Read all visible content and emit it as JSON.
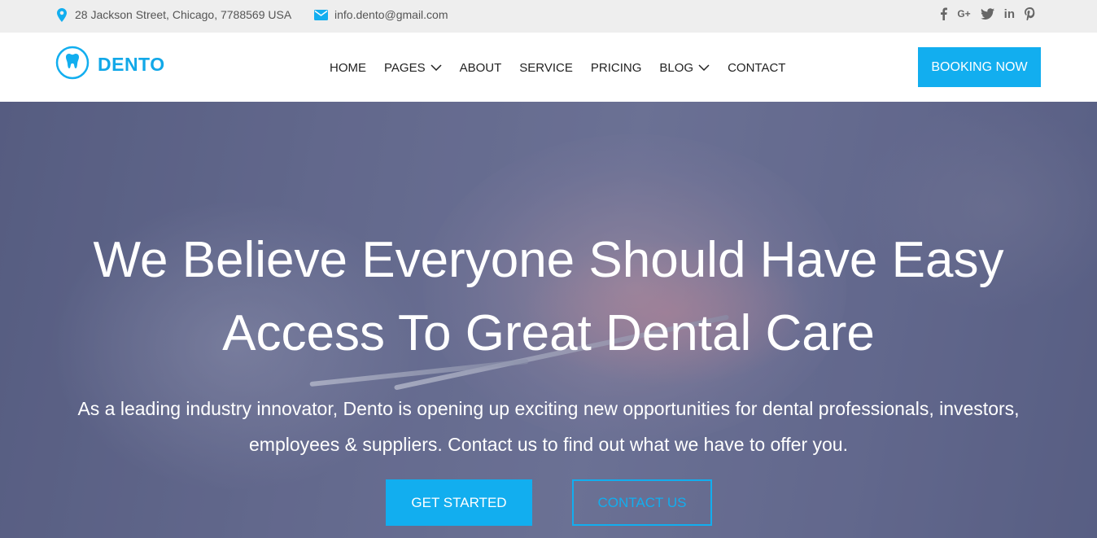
{
  "topbar": {
    "address": "28 Jackson Street, Chicago, 7788569 USA",
    "email": "info.dento@gmail.com",
    "address_icon": "map-pin-icon",
    "email_icon": "envelope-icon",
    "social": [
      {
        "icon": "facebook-icon",
        "glyph": "f"
      },
      {
        "icon": "google-plus-icon",
        "glyph": "G+"
      },
      {
        "icon": "twitter-icon",
        "glyph": ""
      },
      {
        "icon": "linkedin-icon",
        "glyph": "in"
      },
      {
        "icon": "pinterest-icon",
        "glyph": "P"
      }
    ]
  },
  "brand": {
    "name": "DENTO",
    "logo_icon": "tooth-icon",
    "accent": "#12aeef"
  },
  "nav": {
    "items": [
      {
        "label": "HOME"
      },
      {
        "label": "PAGES",
        "has_dropdown": true
      },
      {
        "label": "ABOUT"
      },
      {
        "label": "SERVICE"
      },
      {
        "label": "PRICING"
      },
      {
        "label": "BLOG",
        "has_dropdown": true
      },
      {
        "label": "CONTACT"
      }
    ],
    "cta": "BOOKING NOW"
  },
  "hero": {
    "title_line1": "We Believe Everyone Should Have Easy",
    "title_line2": "Access To Great Dental Care",
    "lead_line1": "As a leading industry innovator, Dento is opening up exciting new opportunities for dental professionals, investors,",
    "lead_line2": "employees & suppliers. Contact us to find out what we have to offer you.",
    "primary_button": "GET STARTED",
    "secondary_button": "CONTACT US"
  }
}
